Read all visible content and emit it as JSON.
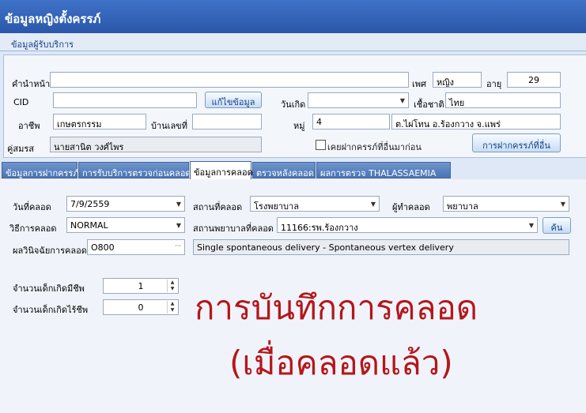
{
  "window": {
    "title": "ข้อมูลหญิงตั้งครรภ์"
  },
  "patient_section": {
    "header": "ข้อมูลผู้รับบริการ"
  },
  "patient": {
    "prefix_label": "คำนำหน้า",
    "sex_label": "เพศ",
    "sex_value": "หญิง",
    "age_label": "อายุ",
    "age_value": "29",
    "cid_label": "CID",
    "cid_value": "",
    "edit_button": "แก้ไขข้อมูล",
    "birthdate_label": "วันเกิด",
    "birthdate_value": "",
    "ethnicity_label": "เชื้อชาติ",
    "ethnicity_value": "ไทย",
    "occupation_label": "อาชีพ",
    "occupation_value": "เกษตรกรรม",
    "house_no_label": "บ้านเลขที่",
    "house_no_value": "",
    "moo_label": "หมู่",
    "moo_value": "4",
    "address_value": "ต.ไผ่โทน อ.ร้องกวาง จ.แพร่",
    "spouse_label": "คู่สมรส",
    "spouse_value": "นายสานิต วงศ์ไพร",
    "other_prenatal_checkbox": "เคยฝากครรภ์ที่อื่นมาก่อน",
    "other_prenatal_button": "การฝากครรภ์ที่อื่น"
  },
  "tabs": [
    "ข้อมูลการฝากครรภ์",
    "การรับบริการตรวจก่อนคลอด",
    "ข้อมูลการคลอด",
    "ตรวจหลังคลอด",
    "ผลการตรวจ THALASSAEMIA"
  ],
  "delivery": {
    "date_label": "วันที่คลอด",
    "date_value": "7/9/2559",
    "place_label": "สถานที่คลอด",
    "place_value": "โรงพยาบาล",
    "attendant_label": "ผู้ทำคลอด",
    "attendant_value": "พยาบาล",
    "method_label": "วิธีการคลอด",
    "method_value": "NORMAL",
    "hospital_label": "สถานพยาบาลที่คลอด",
    "hospital_value": "11166:รพ.ร้องกวาง",
    "search_button": "ค้น",
    "diagnosis_label": "ผลวินิจฉัยการคลอด",
    "diagnosis_code": "O800",
    "ellipsis": "···",
    "diagnosis_desc": "Single spontaneous delivery - Spontaneous vertex delivery",
    "live_births_label": "จำนวนเด็กเกิดมีชีพ",
    "live_births_value": "1",
    "stillbirths_label": "จำนวนเด็กเกิดไร้ชีพ",
    "stillbirths_value": "0"
  },
  "annotation": {
    "line1": "การบันทึกการคลอด",
    "line2": "(เมื่อคลอดแล้ว)",
    "color": "#b5161b"
  },
  "icons": {
    "dropdown": "▼",
    "spin_up": "▲",
    "spin_down": "▼"
  }
}
